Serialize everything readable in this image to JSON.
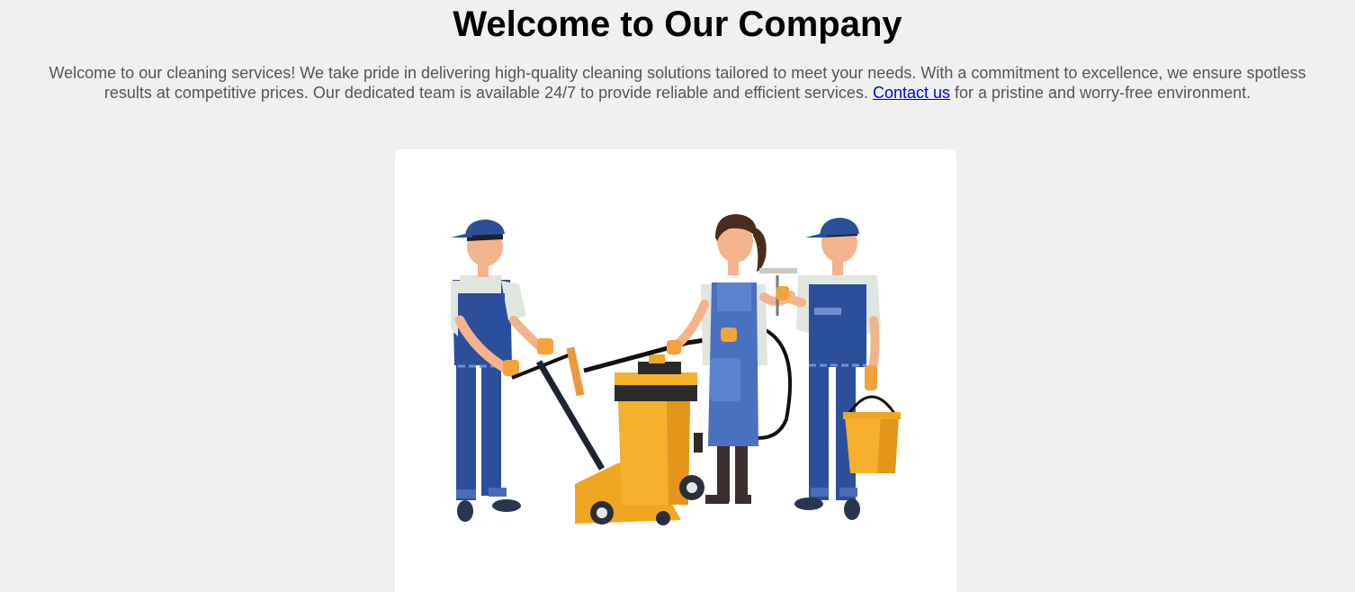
{
  "page": {
    "title": "Welcome to Our Company",
    "intro_before": "Welcome to our cleaning services! We take pride in delivering high-quality cleaning solutions tailored to meet your needs. With a commitment to excellence, we ensure spotless results at competitive prices. Our dedicated team is available 24/7 to provide reliable and efficient services. ",
    "contact_link": "Contact us",
    "intro_after": " for a pristine and worry-free environment."
  },
  "illustration": {
    "icon": "cleaning-team-illustration",
    "colors": {
      "uniform": "#2c4f9b",
      "shirt": "#dfe6df",
      "skin": "#f3b38d",
      "accent": "#f6b02c",
      "dark": "#2b2b2b"
    }
  }
}
